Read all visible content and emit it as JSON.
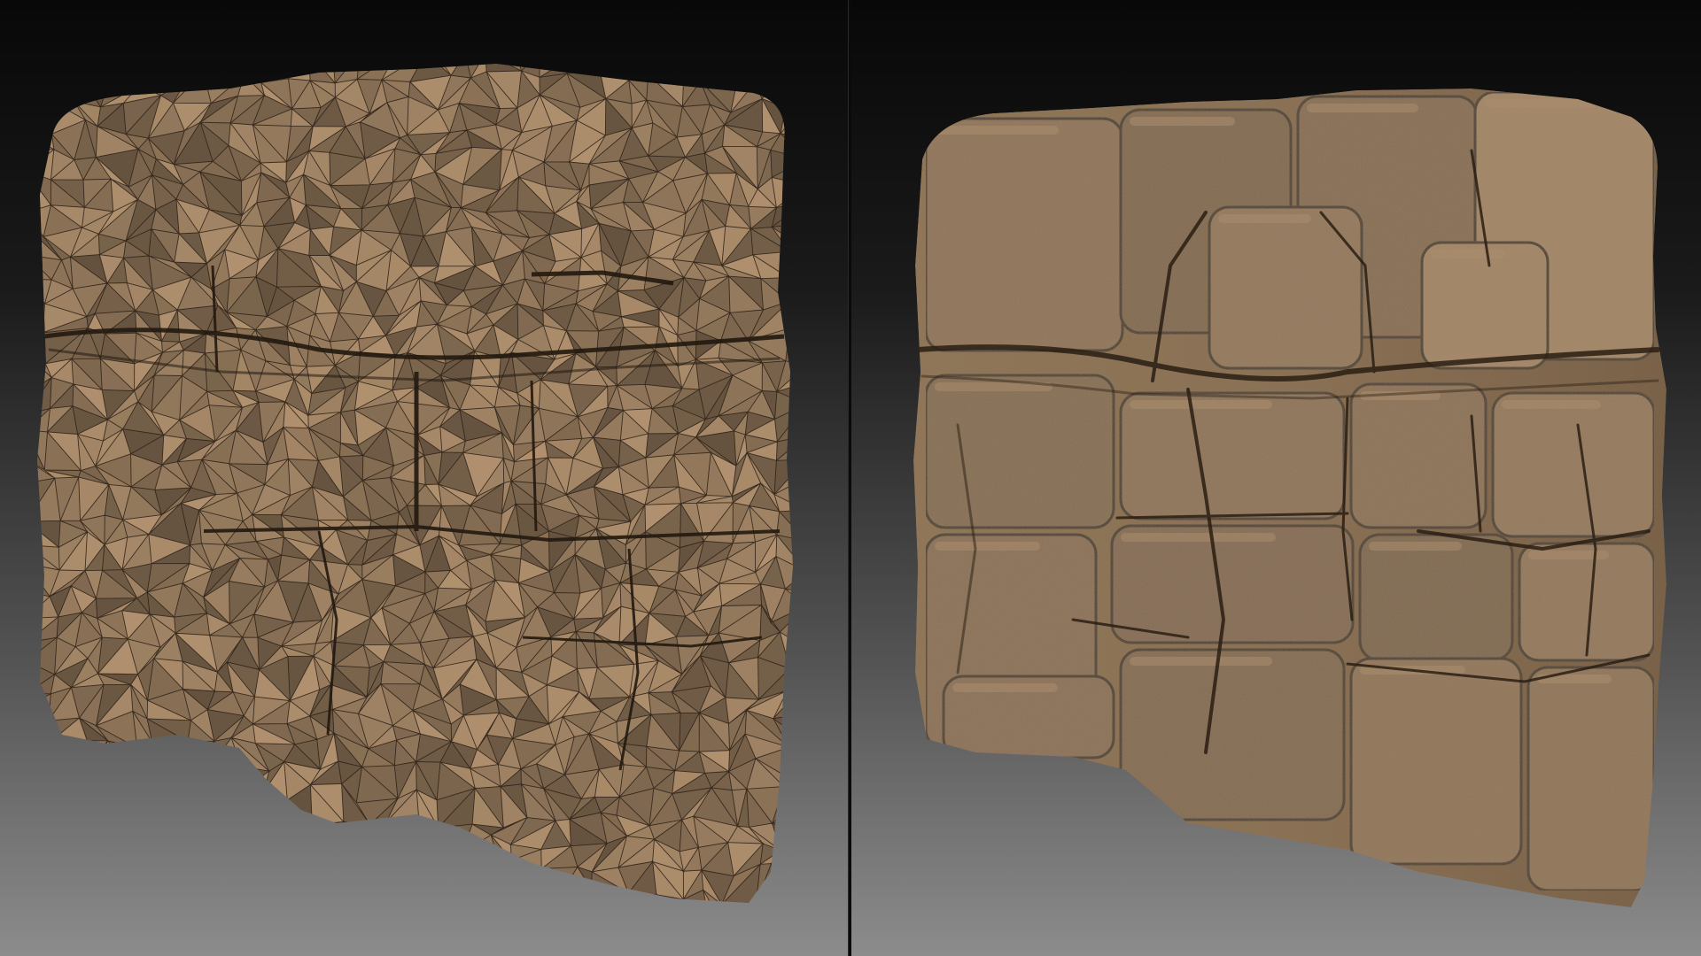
{
  "scene": {
    "panels": [
      {
        "name": "low-poly-wireframe-view",
        "shading": "flat-with-wireframe"
      },
      {
        "name": "high-poly-sculpted-view",
        "shading": "smooth-sculpted"
      }
    ],
    "colors": {
      "background_top": "#0b0b0b",
      "background_bottom": "#8a8a8a",
      "rock_base": "#8b7257",
      "rock_light": "#a68a6b",
      "rock_dark": "#4e3d2c",
      "wire": "#2b2117",
      "divider": "#0a0a0a"
    }
  }
}
